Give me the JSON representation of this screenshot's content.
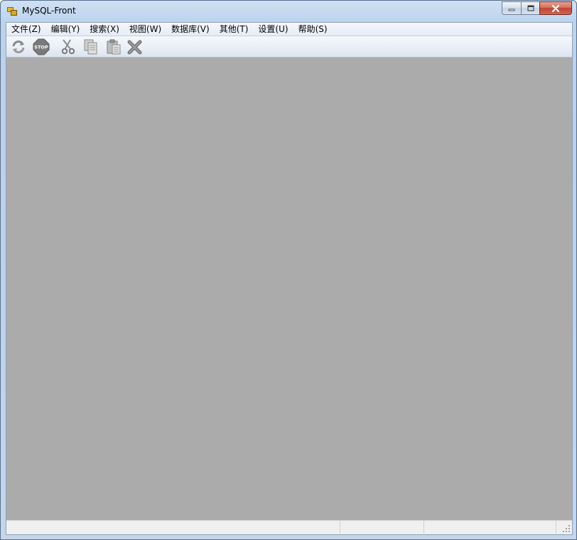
{
  "window": {
    "title": "MySQL-Front",
    "icon": "mysql-front-app-icon"
  },
  "window_controls": {
    "minimize_icon": "minimize-icon",
    "maximize_icon": "maximize-icon",
    "close_icon": "close-icon"
  },
  "menu": {
    "items": [
      {
        "label": "文件(Z)"
      },
      {
        "label": "编辑(Y)"
      },
      {
        "label": "搜索(X)"
      },
      {
        "label": "视图(W)"
      },
      {
        "label": "数据库(V)"
      },
      {
        "label": "其他(T)"
      },
      {
        "label": "设置(U)"
      },
      {
        "label": "帮助(S)"
      }
    ]
  },
  "toolbar": {
    "buttons": [
      {
        "icon": "refresh-icon"
      },
      {
        "icon": "stop-icon",
        "text": "STOP"
      },
      {
        "icon": "cut-icon"
      },
      {
        "icon": "copy-icon"
      },
      {
        "icon": "paste-icon"
      },
      {
        "icon": "delete-icon"
      }
    ]
  },
  "colors": {
    "mdi_background": "#ababab",
    "titlebar": "#c5d9ef",
    "close_button": "#c8503d"
  },
  "statusbar": {
    "panels": [
      "",
      "",
      ""
    ]
  }
}
